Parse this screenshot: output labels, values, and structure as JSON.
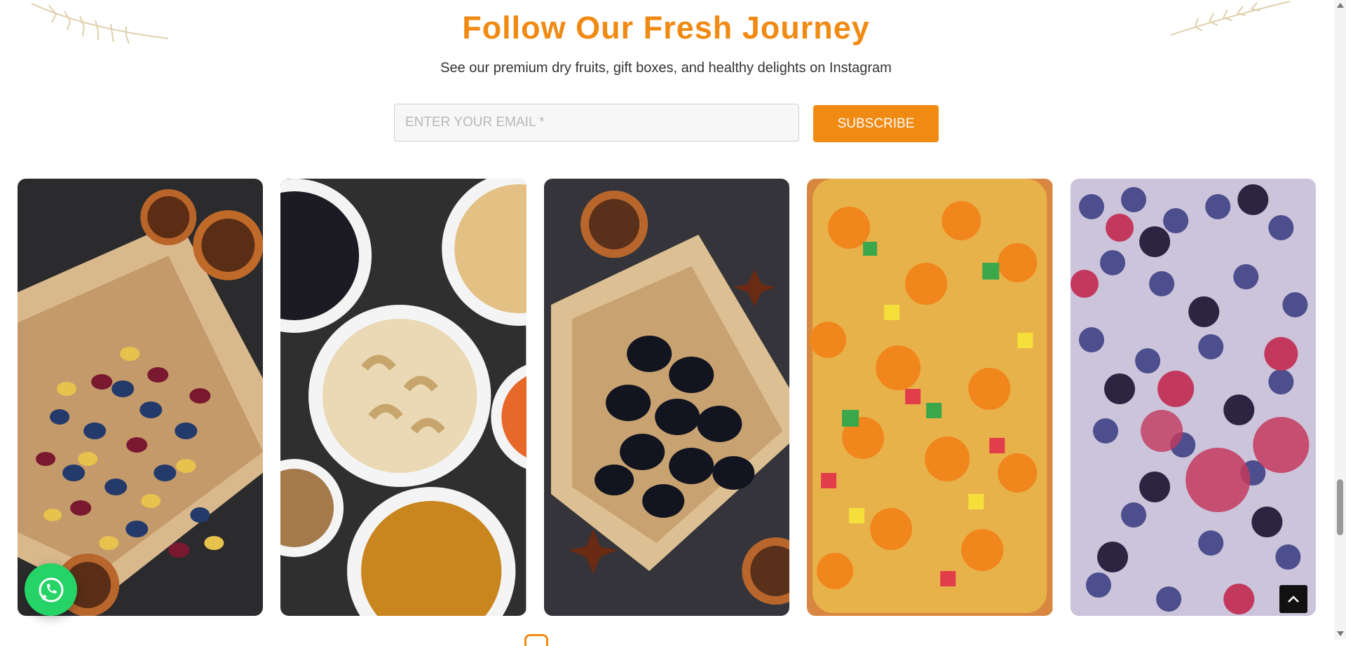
{
  "newsletter": {
    "title": "Follow Our Fresh Journey",
    "subtitle": "See our premium dry fruits, gift boxes, and healthy delights on Instagram",
    "email_placeholder": "ENTER YOUR EMAIL *",
    "email_value": "",
    "subscribe_label": "SUBSCRIBE"
  },
  "gallery": {
    "items": [
      {
        "icon": "raisins-cranberries-photo"
      },
      {
        "icon": "nuts-bowls-photo"
      },
      {
        "icon": "prunes-photo"
      },
      {
        "icon": "apricots-mixed-fruit-photo"
      },
      {
        "icon": "berries-photo"
      }
    ]
  },
  "floating": {
    "whatsapp_icon": "whatsapp-icon",
    "back_to_top_icon": "chevron-up-icon"
  },
  "colors": {
    "accent": "#f08a12",
    "whatsapp": "#25d366"
  }
}
